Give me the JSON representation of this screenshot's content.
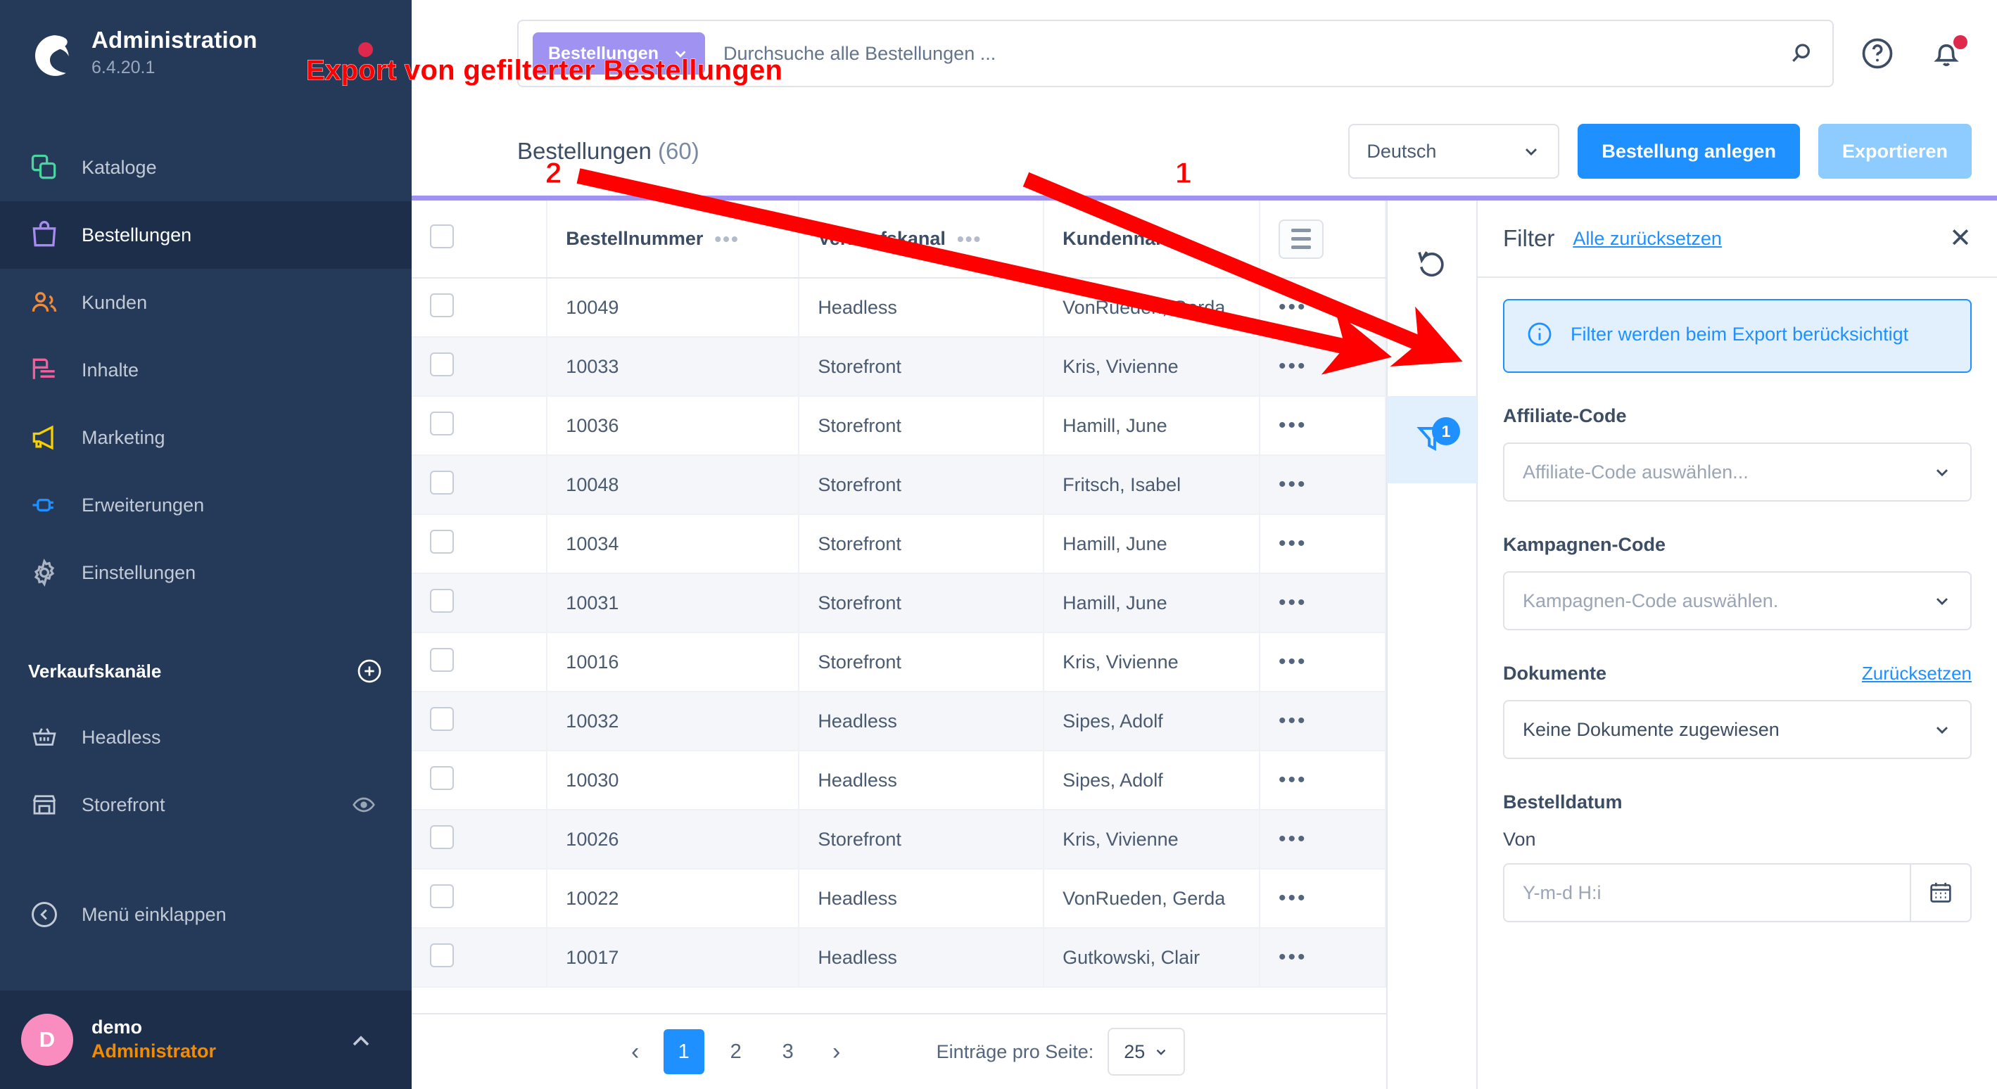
{
  "sidebar": {
    "title": "Administration",
    "version": "6.4.20.1",
    "items": [
      {
        "label": "Kataloge",
        "icon": "catalog-icon",
        "color": "#4cd4a0"
      },
      {
        "label": "Bestellungen",
        "icon": "bag-icon",
        "color": "#a78bf0"
      },
      {
        "label": "Kunden",
        "icon": "users-icon",
        "color": "#f08b3c"
      },
      {
        "label": "Inhalte",
        "icon": "content-icon",
        "color": "#f35f9b"
      },
      {
        "label": "Marketing",
        "icon": "megaphone-icon",
        "color": "#f5cf00"
      },
      {
        "label": "Erweiterungen",
        "icon": "plugin-icon",
        "color": "#1e90ff"
      },
      {
        "label": "Einstellungen",
        "icon": "gear-icon",
        "color": "#aab4c2"
      }
    ],
    "section_label": "Verkaufskanäle",
    "channels": [
      {
        "label": "Headless",
        "icon": "basket-icon"
      },
      {
        "label": "Storefront",
        "icon": "shop-icon"
      }
    ],
    "collapse_label": "Menü einklappen",
    "user": {
      "initial": "D",
      "name": "demo",
      "role": "Administrator"
    }
  },
  "topbar": {
    "scope_label": "Bestellungen",
    "search_placeholder": "Durchsuche alle Bestellungen ...",
    "search_value": ""
  },
  "header": {
    "page_title": "Bestellungen",
    "page_count": "(60)",
    "language_value": "Deutsch",
    "create_button": "Bestellung anlegen",
    "export_button": "Exportieren"
  },
  "table": {
    "columns": [
      "Bestellnummer",
      "Verkaufskanal",
      "Kundenname"
    ],
    "rows": [
      {
        "number": "10049",
        "channel": "Headless",
        "customer": "VonRueden, Gerda"
      },
      {
        "number": "10033",
        "channel": "Storefront",
        "customer": "Kris, Vivienne"
      },
      {
        "number": "10036",
        "channel": "Storefront",
        "customer": "Hamill, June"
      },
      {
        "number": "10048",
        "channel": "Storefront",
        "customer": "Fritsch, Isabel"
      },
      {
        "number": "10034",
        "channel": "Storefront",
        "customer": "Hamill, June"
      },
      {
        "number": "10031",
        "channel": "Storefront",
        "customer": "Hamill, June"
      },
      {
        "number": "10016",
        "channel": "Storefront",
        "customer": "Kris, Vivienne"
      },
      {
        "number": "10032",
        "channel": "Headless",
        "customer": "Sipes, Adolf"
      },
      {
        "number": "10030",
        "channel": "Headless",
        "customer": "Sipes, Adolf"
      },
      {
        "number": "10026",
        "channel": "Storefront",
        "customer": "Kris, Vivienne"
      },
      {
        "number": "10022",
        "channel": "Headless",
        "customer": "VonRueden, Gerda"
      },
      {
        "number": "10017",
        "channel": "Headless",
        "customer": "Gutkowski, Clair"
      }
    ],
    "row_action_glyph": "•••"
  },
  "pagination": {
    "pages": [
      "1",
      "2",
      "3"
    ],
    "active_page": "1",
    "per_page_label": "Einträge pro Seite:",
    "per_page_value": "25"
  },
  "rail": {
    "refresh_icon": "refresh-icon",
    "export_icon": "cloud-download-icon",
    "filter_icon": "filter-icon",
    "filter_badge": "1"
  },
  "filter_panel": {
    "title": "Filter",
    "reset_all": "Alle zurücksetzen",
    "info_text": "Filter werden beim Export berücksichtigt",
    "affiliate_label": "Affiliate-Code",
    "affiliate_placeholder": "Affiliate-Code auswählen...",
    "campaign_label": "Kampagnen-Code",
    "campaign_placeholder": "Kampagnen-Code auswählen.",
    "documents_label": "Dokumente",
    "documents_reset": "Zurücksetzen",
    "documents_value": "Keine Dokumente zugewiesen",
    "orderdate_label": "Bestelldatum",
    "from_label": "Von",
    "from_placeholder": "Y-m-d H:i"
  },
  "annotations": {
    "title": "Export von gefilterter Bestellungen",
    "marker_1": "1",
    "marker_2": "2",
    "color": "#ff0000"
  }
}
